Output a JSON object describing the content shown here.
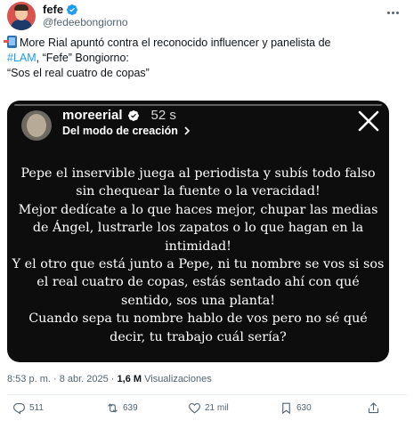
{
  "author": {
    "display_name": "fefe",
    "handle": "@fedeebongiorno"
  },
  "tweet": {
    "lines": [
      {
        "emoji": "phone-arrow-emoji",
        "text": "More Rial apuntó contra el reconocido influencer y panelista de"
      },
      {
        "hashtag": "#LAM",
        "text": ", “Fefe” Bongiorno:"
      },
      {
        "text": "“Sos el real cuatro de copas”"
      }
    ]
  },
  "story": {
    "username": "moreerial",
    "time": "52 s",
    "mode": "Del modo de creación",
    "lines": [
      "Pepe el inservible juega al periodista y subís todo falso",
      "sin chequear la fuente o la veracidad!",
      "Mejor dedícate a lo que haces mejor, chupar las medias",
      "de Ángel, lustrarle los zapatos o lo que hagan en la",
      "intimidad!",
      "Y el otro que está junto a Pepe, ni tu nombre se vos si sos",
      "el real cuatro de copas, estás sentado ahí con qué",
      "sentido, sos una planta!",
      "Cuando sepa tu nombre hablo de vos pero no sé qué",
      "decir, tu trabajo cuál sería?"
    ]
  },
  "meta": {
    "timestamp": "8:53 p. m. · 8 abr. 2025 ·",
    "views_count": "1,6 M",
    "views_label": "Visualizaciones"
  },
  "actions": {
    "replies": "511",
    "reposts": "639",
    "likes": "21 mil",
    "bookmarks": "630"
  },
  "colors": {
    "accent": "#1d9bf0",
    "text": "#0f1419",
    "muted": "#536471",
    "story_bg": "#0d0d0d"
  }
}
